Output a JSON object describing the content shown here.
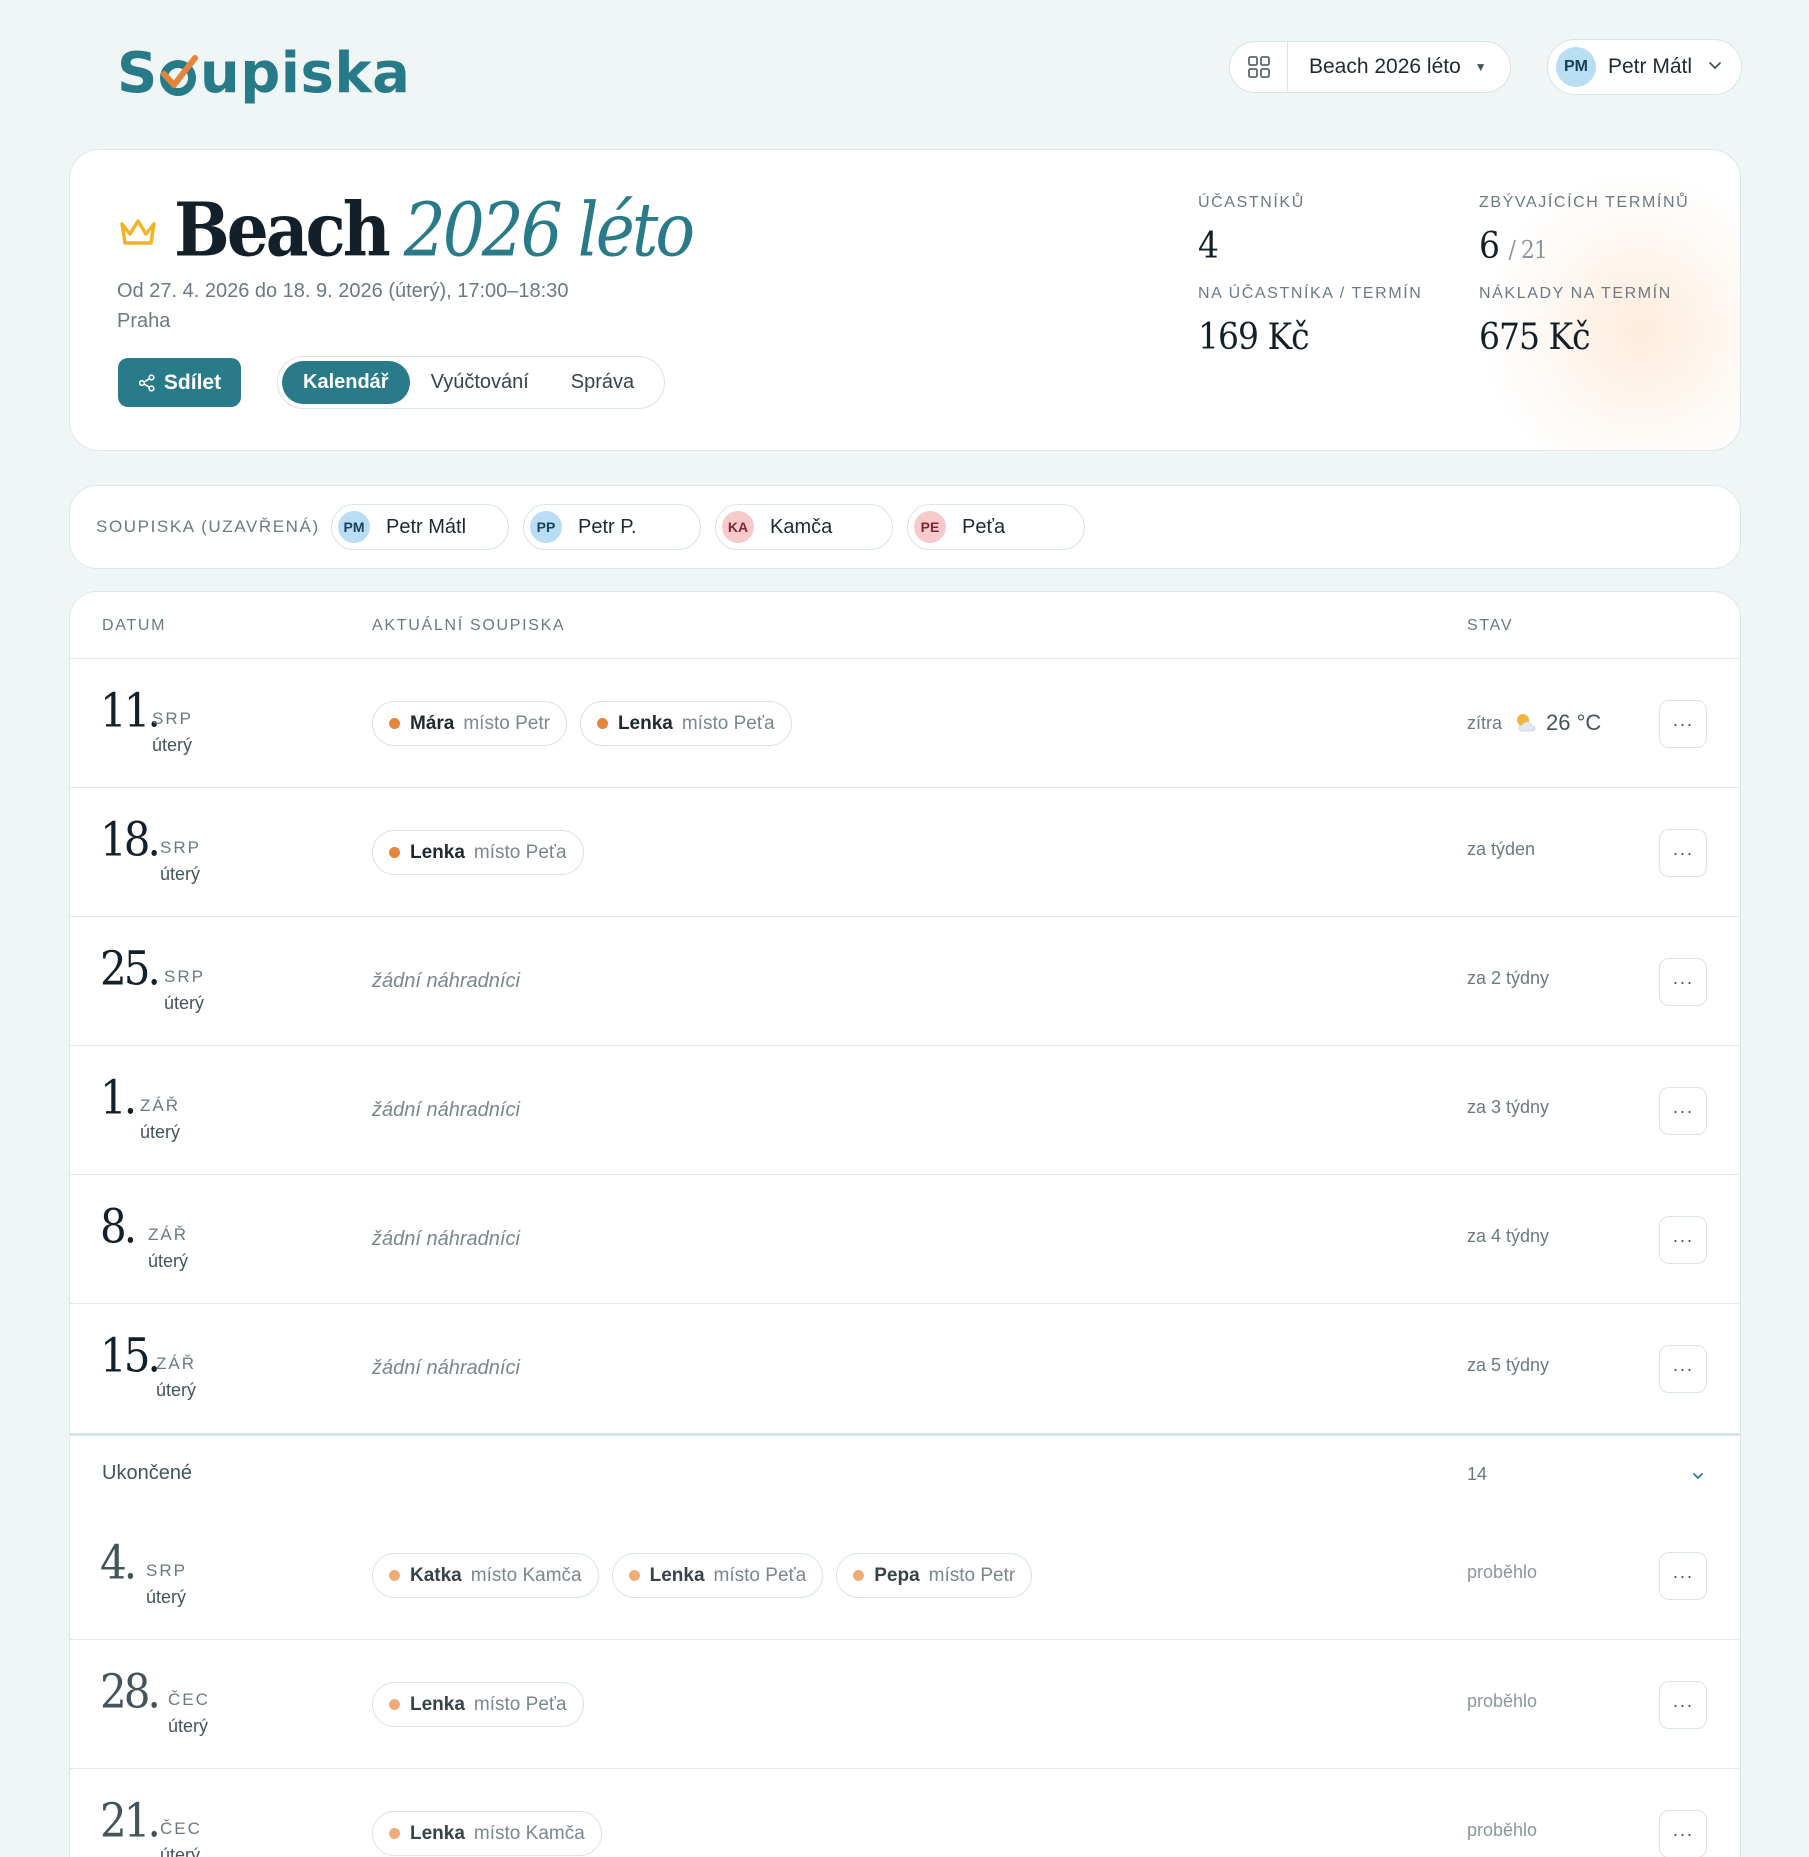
{
  "app": {
    "logo": "Soupiska",
    "logo_parts": [
      "S",
      "upiska"
    ]
  },
  "header": {
    "season_switch": {
      "label": "Beach 2026 léto",
      "grid_icon": "grid-icon",
      "caret_icon": "caret-down-icon"
    },
    "user": {
      "initials": "PM",
      "name": "Petr Mátl",
      "chevron_icon": "chevron-down-icon"
    }
  },
  "hero": {
    "title_main": "Beach",
    "title_accent": "2026 léto",
    "dates": "Od 27. 4. 2026 do 18. 9. 2026 (úterý), 17:00–18:30",
    "place": "Praha",
    "share_label": "Sdílet",
    "tabs": [
      {
        "label": "Kalendář",
        "active": true
      },
      {
        "label": "Vyúčtování",
        "active": false
      },
      {
        "label": "Správa",
        "active": false
      }
    ],
    "stats": {
      "participants_label": "ÚČASTNÍKŮ",
      "participants_value": "4",
      "remaining_label": "ZBÝVAJÍCÍCH TERMÍNŮ",
      "remaining_value": "6",
      "remaining_total": "/ 21",
      "per_person_label": "NA ÚČASTNÍKA / TERMÍN",
      "per_person_value": "169 Kč",
      "cost_label": "NÁKLADY NA TERMÍN",
      "cost_value": "675 Kč"
    }
  },
  "roster": {
    "label": "SOUPISKA (UZAVŘENÁ)",
    "members": [
      {
        "initials": "PM",
        "name": "Petr Mátl",
        "color": "#b9ddf3",
        "text_color": "#18425a"
      },
      {
        "initials": "PP",
        "name": "Petr P.",
        "color": "#b9ddf3",
        "text_color": "#18425a"
      },
      {
        "initials": "KA",
        "name": "Kamča",
        "color": "#f7c9cc",
        "text_color": "#7a2a30"
      },
      {
        "initials": "PE",
        "name": "Peťa",
        "color": "#f7c9cc",
        "text_color": "#7a2a30"
      }
    ]
  },
  "table": {
    "col_date": "DATUM",
    "col_roster": "AKTUÁLNÍ SOUPISKA",
    "col_status": "STAV",
    "empty_text": "žádní náhradníci",
    "more_label": "···",
    "upcoming": [
      {
        "day": "11.",
        "month": "SRP",
        "weekday": "úterý",
        "subs": [
          {
            "who": "Mára",
            "for": "místo Petr"
          },
          {
            "who": "Lenka",
            "for": "místo Peťa"
          }
        ],
        "status": "zítra",
        "weather_icon": "sun-cloud-icon",
        "temp": "26 °C"
      },
      {
        "day": "18.",
        "month": "SRP",
        "weekday": "úterý",
        "subs": [
          {
            "who": "Lenka",
            "for": "místo Peťa"
          }
        ],
        "status": "za týden"
      },
      {
        "day": "25.",
        "month": "SRP",
        "weekday": "úterý",
        "subs": [],
        "status": "za 2 týdny"
      },
      {
        "day": "1.",
        "month": "ZÁŘ",
        "weekday": "úterý",
        "subs": [],
        "status": "za 3 týdny"
      },
      {
        "day": "8.",
        "month": "ZÁŘ",
        "weekday": "úterý",
        "subs": [],
        "status": "za 4 týdny"
      },
      {
        "day": "15.",
        "month": "ZÁŘ",
        "weekday": "úterý",
        "subs": [],
        "status": "za 5 týdny"
      }
    ],
    "ended": {
      "label": "Ukončené",
      "count": "14",
      "rows": [
        {
          "day": "4.",
          "month": "SRP",
          "weekday": "úterý",
          "subs": [
            {
              "who": "Katka",
              "for": "místo Kamča"
            },
            {
              "who": "Lenka",
              "for": "místo Peťa"
            },
            {
              "who": "Pepa",
              "for": "místo Petr"
            }
          ],
          "status": "proběhlo"
        },
        {
          "day": "28.",
          "month": "ČEC",
          "weekday": "úterý",
          "subs": [
            {
              "who": "Lenka",
              "for": "místo Peťa"
            }
          ],
          "status": "proběhlo"
        },
        {
          "day": "21.",
          "month": "ČEC",
          "weekday": "úterý",
          "subs": [
            {
              "who": "Lenka",
              "for": "místo Kamča"
            }
          ],
          "status": "proběhlo"
        }
      ]
    }
  },
  "colors": {
    "accent": "#2a7b8a",
    "sub_dot": "#e5843c",
    "crown": "#f0b429",
    "background": "#eff6f5"
  }
}
